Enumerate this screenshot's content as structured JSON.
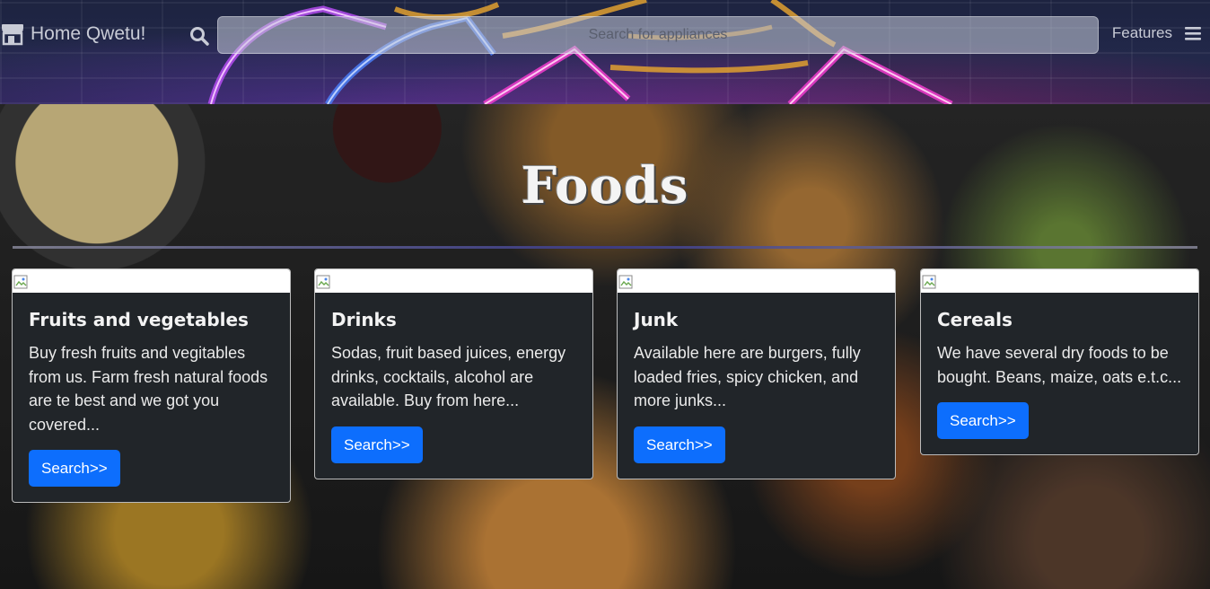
{
  "navbar": {
    "brand_label": "Home Qwetu!",
    "search_placeholder": "Search for appliances",
    "features_label": "Features"
  },
  "hero": {
    "title": "Foods"
  },
  "cards": [
    {
      "title": "Fruits and vegetables",
      "text": "Buy fresh fruits and vegitables from us. Farm fresh natural foods are te best and we got you covered...",
      "button_label": "Search>>"
    },
    {
      "title": "Drinks",
      "text": "Sodas, fruit based juices, energy drinks, cocktails, alcohol are available. Buy from here...",
      "button_label": "Search>>"
    },
    {
      "title": "Junk",
      "text": "Available here are burgers, fully loaded fries, spicy chicken, and more junks...",
      "button_label": "Search>>"
    },
    {
      "title": "Cereals",
      "text": "We have several dry foods to be bought. Beans, maize, oats e.t.c...",
      "button_label": "Search>>"
    }
  ],
  "icons": {
    "brand": "store-icon",
    "search": "search-icon",
    "menu": "hamburger-menu-icon",
    "card_image": "broken-image-icon"
  },
  "colors": {
    "button": "#0d6efd",
    "card_bg": "#212529",
    "header_bg": "#1d2340"
  }
}
